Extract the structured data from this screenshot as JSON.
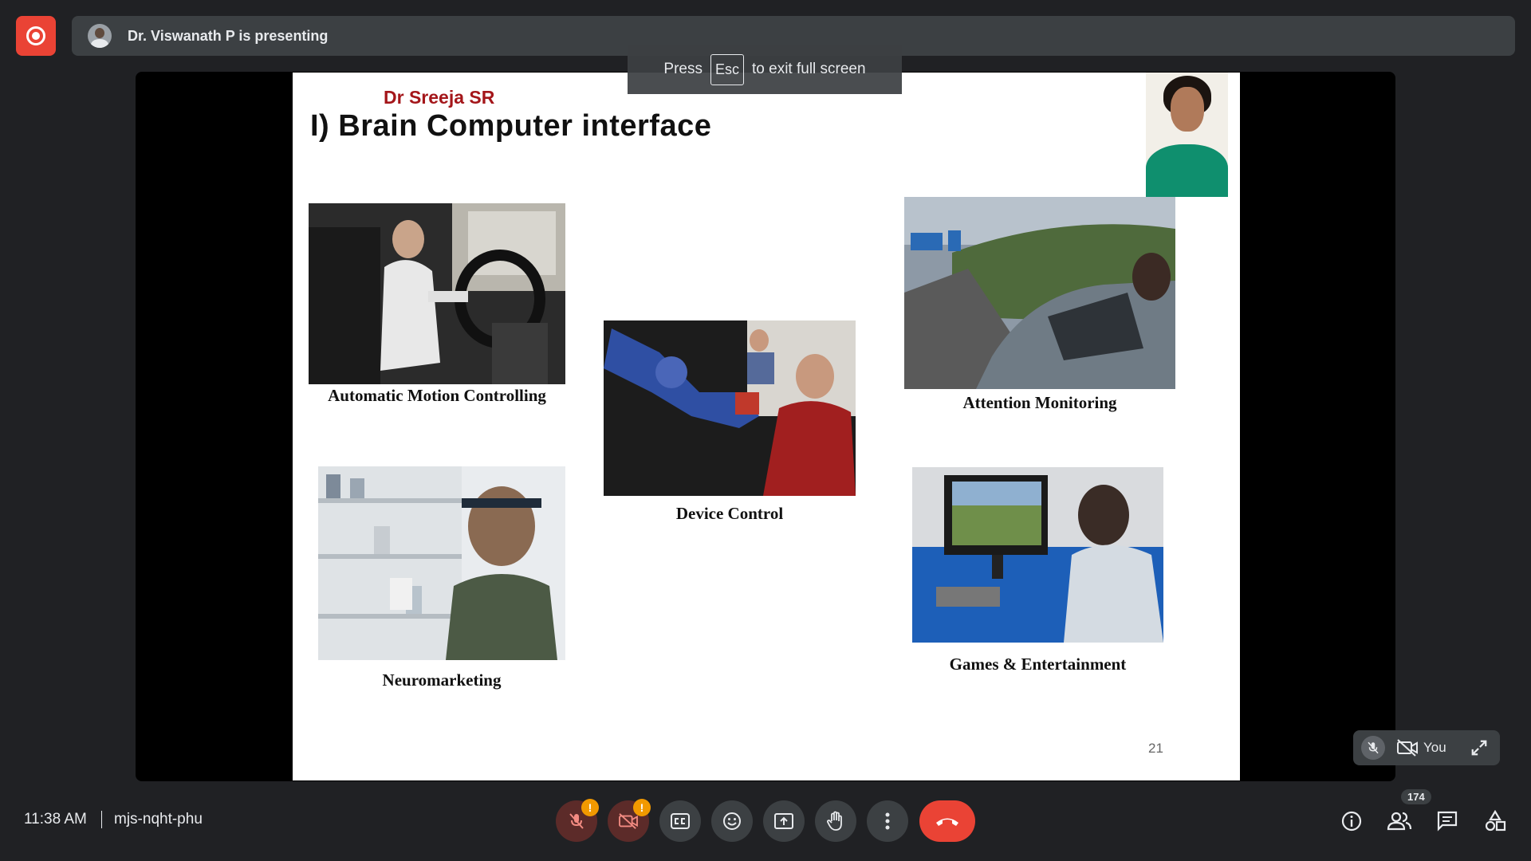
{
  "presenter": {
    "text": "Dr. Viswanath P is presenting"
  },
  "toast": {
    "press": "Press",
    "key": "Esc",
    "rest": "to exit full screen"
  },
  "slide": {
    "author": "Dr Sreeja SR",
    "title": "I) Brain Computer interface",
    "page_number": "21",
    "captions": {
      "motion": "Automatic Motion Controlling",
      "device": "Device Control",
      "attention": "Attention Monitoring",
      "neuro": "Neuromarketing",
      "games": "Games & Entertainment"
    }
  },
  "self_tile": {
    "label": "You"
  },
  "bottom": {
    "time": "11:38 AM",
    "meeting_code": "mjs-nqht-phu",
    "participant_count": "174",
    "warn_mark": "!"
  },
  "icons": [
    "record-icon",
    "mic-off-icon",
    "camera-off-icon",
    "captions-icon",
    "emoji-icon",
    "present-icon",
    "raise-hand-icon",
    "more-options-icon",
    "hang-up-icon",
    "info-icon",
    "people-icon",
    "chat-icon",
    "activities-icon",
    "expand-icon"
  ],
  "colors": {
    "record": "#ea4335",
    "hangup": "#ea4335",
    "warning": "#f29900",
    "title_red": "#a4161a"
  }
}
